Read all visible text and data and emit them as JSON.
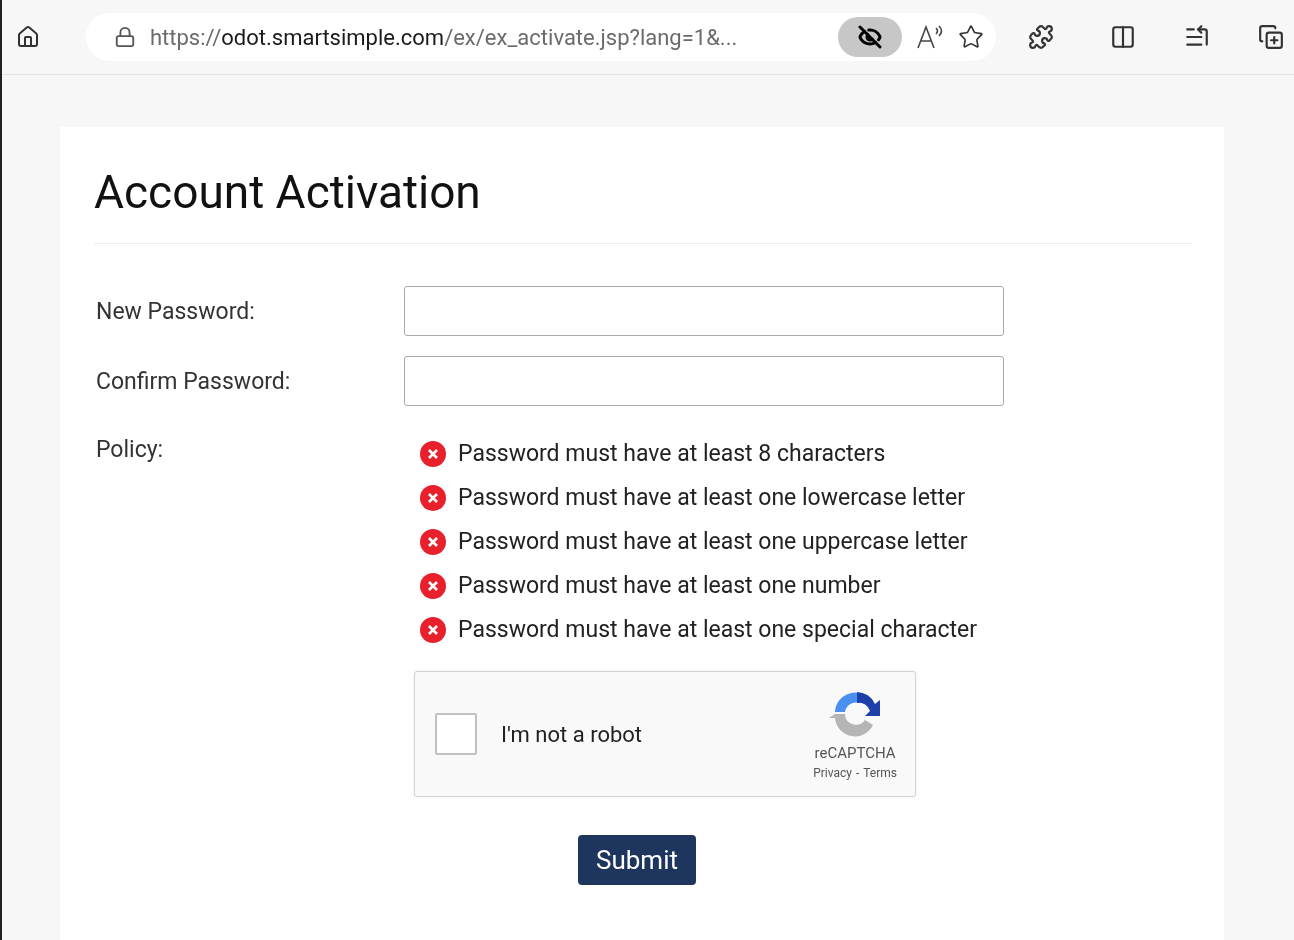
{
  "browser": {
    "url": [
      {
        "kind": "dim",
        "text": "https://"
      },
      {
        "kind": "host",
        "text": "odot.smartsimple.com"
      },
      {
        "kind": "dim",
        "text": "/ex/ex_activate.jsp?lang=1&..."
      }
    ]
  },
  "form": {
    "title": "Account Activation",
    "fields": [
      {
        "label": "New Password:"
      },
      {
        "label": "Confirm Password:"
      }
    ],
    "policy_label": "Policy:",
    "policy": [
      {
        "text": "Password must have at least 8 characters",
        "met": false
      },
      {
        "text": "Password must have at least one lowercase letter",
        "met": false
      },
      {
        "text": "Password must have at least one uppercase letter",
        "met": false
      },
      {
        "text": "Password must have at least one number",
        "met": false
      },
      {
        "text": "Password must have at least one special character",
        "met": false
      }
    ],
    "captcha": {
      "label": "I'm not a robot",
      "checked": false,
      "brand": "reCAPTCHA",
      "privacy": "Privacy",
      "separator": "-",
      "terms": "Terms"
    },
    "submit": "Submit"
  }
}
